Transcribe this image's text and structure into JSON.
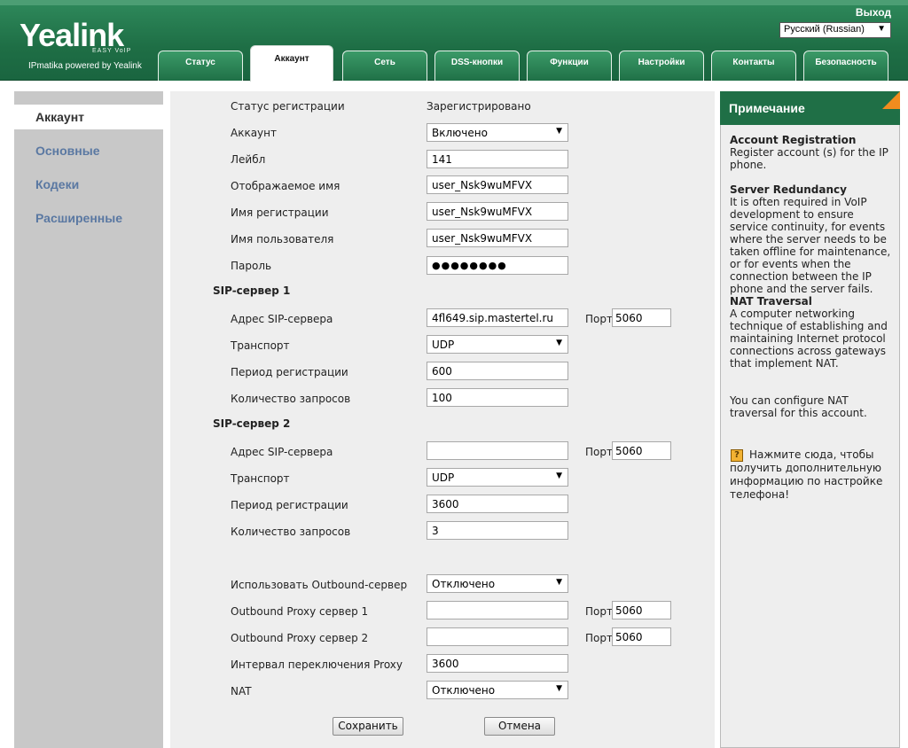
{
  "header": {
    "logo": "Yealink",
    "logo_tag": "EASY VoIP",
    "subtitle": "IPmatika powered by Yealink",
    "exit_label": "Выход",
    "language": "Русский (Russian)"
  },
  "tabs": [
    "Статус",
    "Аккаунт",
    "Сеть",
    "DSS-кнопки",
    "Функции",
    "Настройки",
    "Контакты",
    "Безопасность"
  ],
  "sidebar": {
    "items": [
      "Аккаунт",
      "Основные",
      "Кодеки",
      "Расширенные"
    ]
  },
  "form": {
    "reg_status_label": "Статус регистрации",
    "reg_status_value": "Зарегистрировано",
    "account_label": "Аккаунт",
    "account_value": "Включено",
    "label_label": "Лейбл",
    "label_value": "141",
    "display_name_label": "Отображаемое имя",
    "display_name_value": "user_Nsk9wuMFVX",
    "reg_name_label": "Имя регистрации",
    "reg_name_value": "user_Nsk9wuMFVX",
    "username_label": "Имя пользователя",
    "username_value": "user_Nsk9wuMFVX",
    "password_label": "Пароль",
    "password_value": "●●●●●●●●",
    "sip1_title": "SIP-сервер 1",
    "sip1_addr_label": "Адрес SIP-сервера",
    "sip1_addr_value": "4fl649.sip.mastertel.ru",
    "sip1_port_label": "Порт",
    "sip1_port_value": "5060",
    "sip1_transport_label": "Транспорт",
    "sip1_transport_value": "UDP",
    "sip1_period_label": "Период регистрации",
    "sip1_period_value": "600",
    "sip1_count_label": "Количество запросов",
    "sip1_count_value": "100",
    "sip2_title": "SIP-сервер 2",
    "sip2_addr_label": "Адрес SIP-сервера",
    "sip2_addr_value": "",
    "sip2_port_label": "Порт",
    "sip2_port_value": "5060",
    "sip2_transport_label": "Транспорт",
    "sip2_transport_value": "UDP",
    "sip2_period_label": "Период регистрации",
    "sip2_period_value": "3600",
    "sip2_count_label": "Количество запросов",
    "sip2_count_value": "3",
    "outbound_label": "Использовать Outbound-сервер",
    "outbound_value": "Отключено",
    "proxy1_label": "Outbound Proxy сервер 1",
    "proxy1_value": "",
    "proxy1_port_label": "Порт",
    "proxy1_port_value": "5060",
    "proxy2_label": "Outbound Proxy сервер 2",
    "proxy2_value": "",
    "proxy2_port_label": "Порт",
    "proxy2_port_value": "5060",
    "proxy_interval_label": "Интервал переключения Proxy",
    "proxy_interval_value": "3600",
    "nat_label": "NAT",
    "nat_value": "Отключено",
    "save_label": "Сохранить",
    "cancel_label": "Отмена"
  },
  "note": {
    "title": "Примечание",
    "b1_title": "Account Registration",
    "b1_text": "Register account (s) for the IP phone.",
    "b2_title": "Server Redundancy",
    "b2_text": "It is often required in VoIP development to ensure service continuity, for events where the server needs to be taken offline for maintenance, or for events when the connection between the IP phone and the server fails.",
    "b3_title": "NAT Traversal",
    "b3_text": "A computer networking technique of establishing and maintaining Internet protocol connections across gateways that implement NAT.",
    "b4_text": "You can configure NAT traversal for this account.",
    "help_text": "Нажмите сюда, чтобы получить дополнительную информацию по настройке телефона!"
  },
  "colors": {
    "brand_green": "#1f6f46",
    "accent_orange": "#f28c1e",
    "sidebar_link": "#5a78a2"
  },
  "icons": {
    "help": "help-book-icon",
    "dropdown": "chevron-down-icon"
  }
}
